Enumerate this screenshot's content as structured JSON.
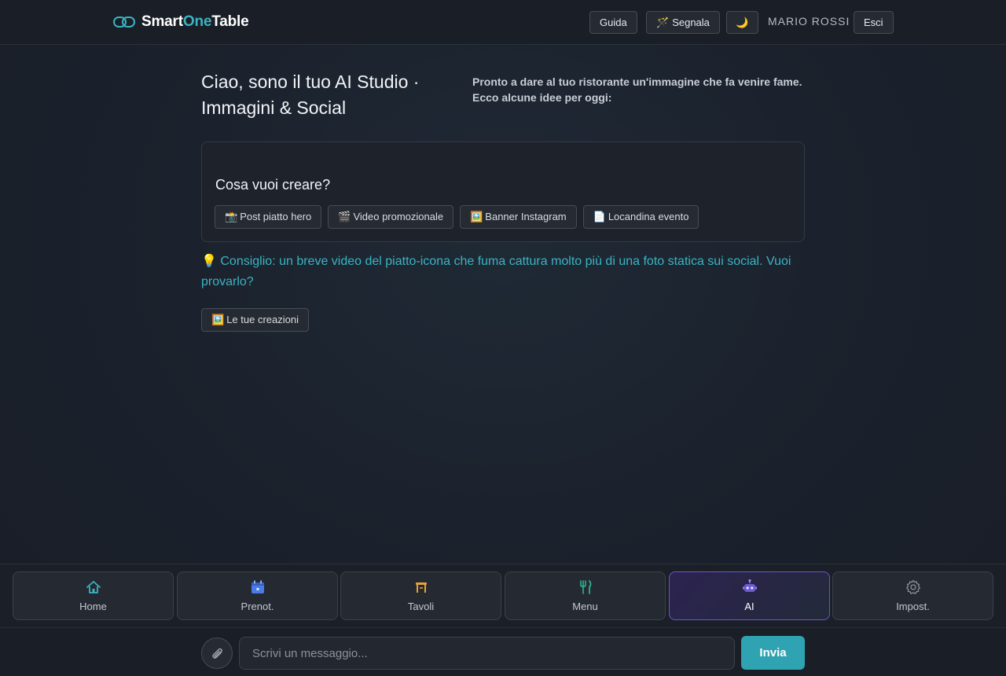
{
  "brand": {
    "name_part1": "Smart",
    "name_part2": "One",
    "name_part3": "Table"
  },
  "header": {
    "guide_label": "Guida",
    "report_icon": "🪄",
    "report_label": "Segnala",
    "theme_icon": "🌙",
    "user_name": "MARIO ROSSI",
    "logout_label": "Esci"
  },
  "hero": {
    "title": "Ciao, sono il tuo AI Studio · Immagini & Social",
    "subtitle": "Pronto a dare al tuo ristorante un'immagine che fa venire fame. Ecco alcune idee per oggi:"
  },
  "create_card": {
    "title": "Cosa vuoi creare?",
    "options": [
      {
        "icon": "📸",
        "label": "Post piatto hero"
      },
      {
        "icon": "🎬",
        "label": "Video promozionale"
      },
      {
        "icon": "🖼️",
        "label": "Banner Instagram"
      },
      {
        "icon": "📄",
        "label": "Locandina evento"
      }
    ]
  },
  "tip": {
    "icon": "💡",
    "text": "Consiglio: un breve video del piatto-icona che fuma cattura molto più di una foto statica sui social. Vuoi provarlo?"
  },
  "creations": {
    "icon": "🖼️",
    "label": "Le tue creazioni"
  },
  "nav": {
    "items": [
      {
        "label": "Home",
        "icon": "home-icon",
        "color": "#3ab3c2"
      },
      {
        "label": "Prenot.",
        "icon": "calendar-icon",
        "color": "#4a7be8"
      },
      {
        "label": "Tavoli",
        "icon": "table-icon",
        "color": "#e8a23a"
      },
      {
        "label": "Menu",
        "icon": "cutlery-icon",
        "color": "#2fb38a"
      },
      {
        "label": "AI",
        "icon": "robot-icon",
        "color": "#8b78e6",
        "active": true
      },
      {
        "label": "Impost.",
        "icon": "gear-icon",
        "color": "#8a919b"
      }
    ]
  },
  "composer": {
    "placeholder": "Scrivi un messaggio...",
    "send_label": "Invia"
  },
  "colors": {
    "accent": "#3ab3c2",
    "send_bg": "#2fa3b2",
    "active_nav": "#6d55c8"
  }
}
